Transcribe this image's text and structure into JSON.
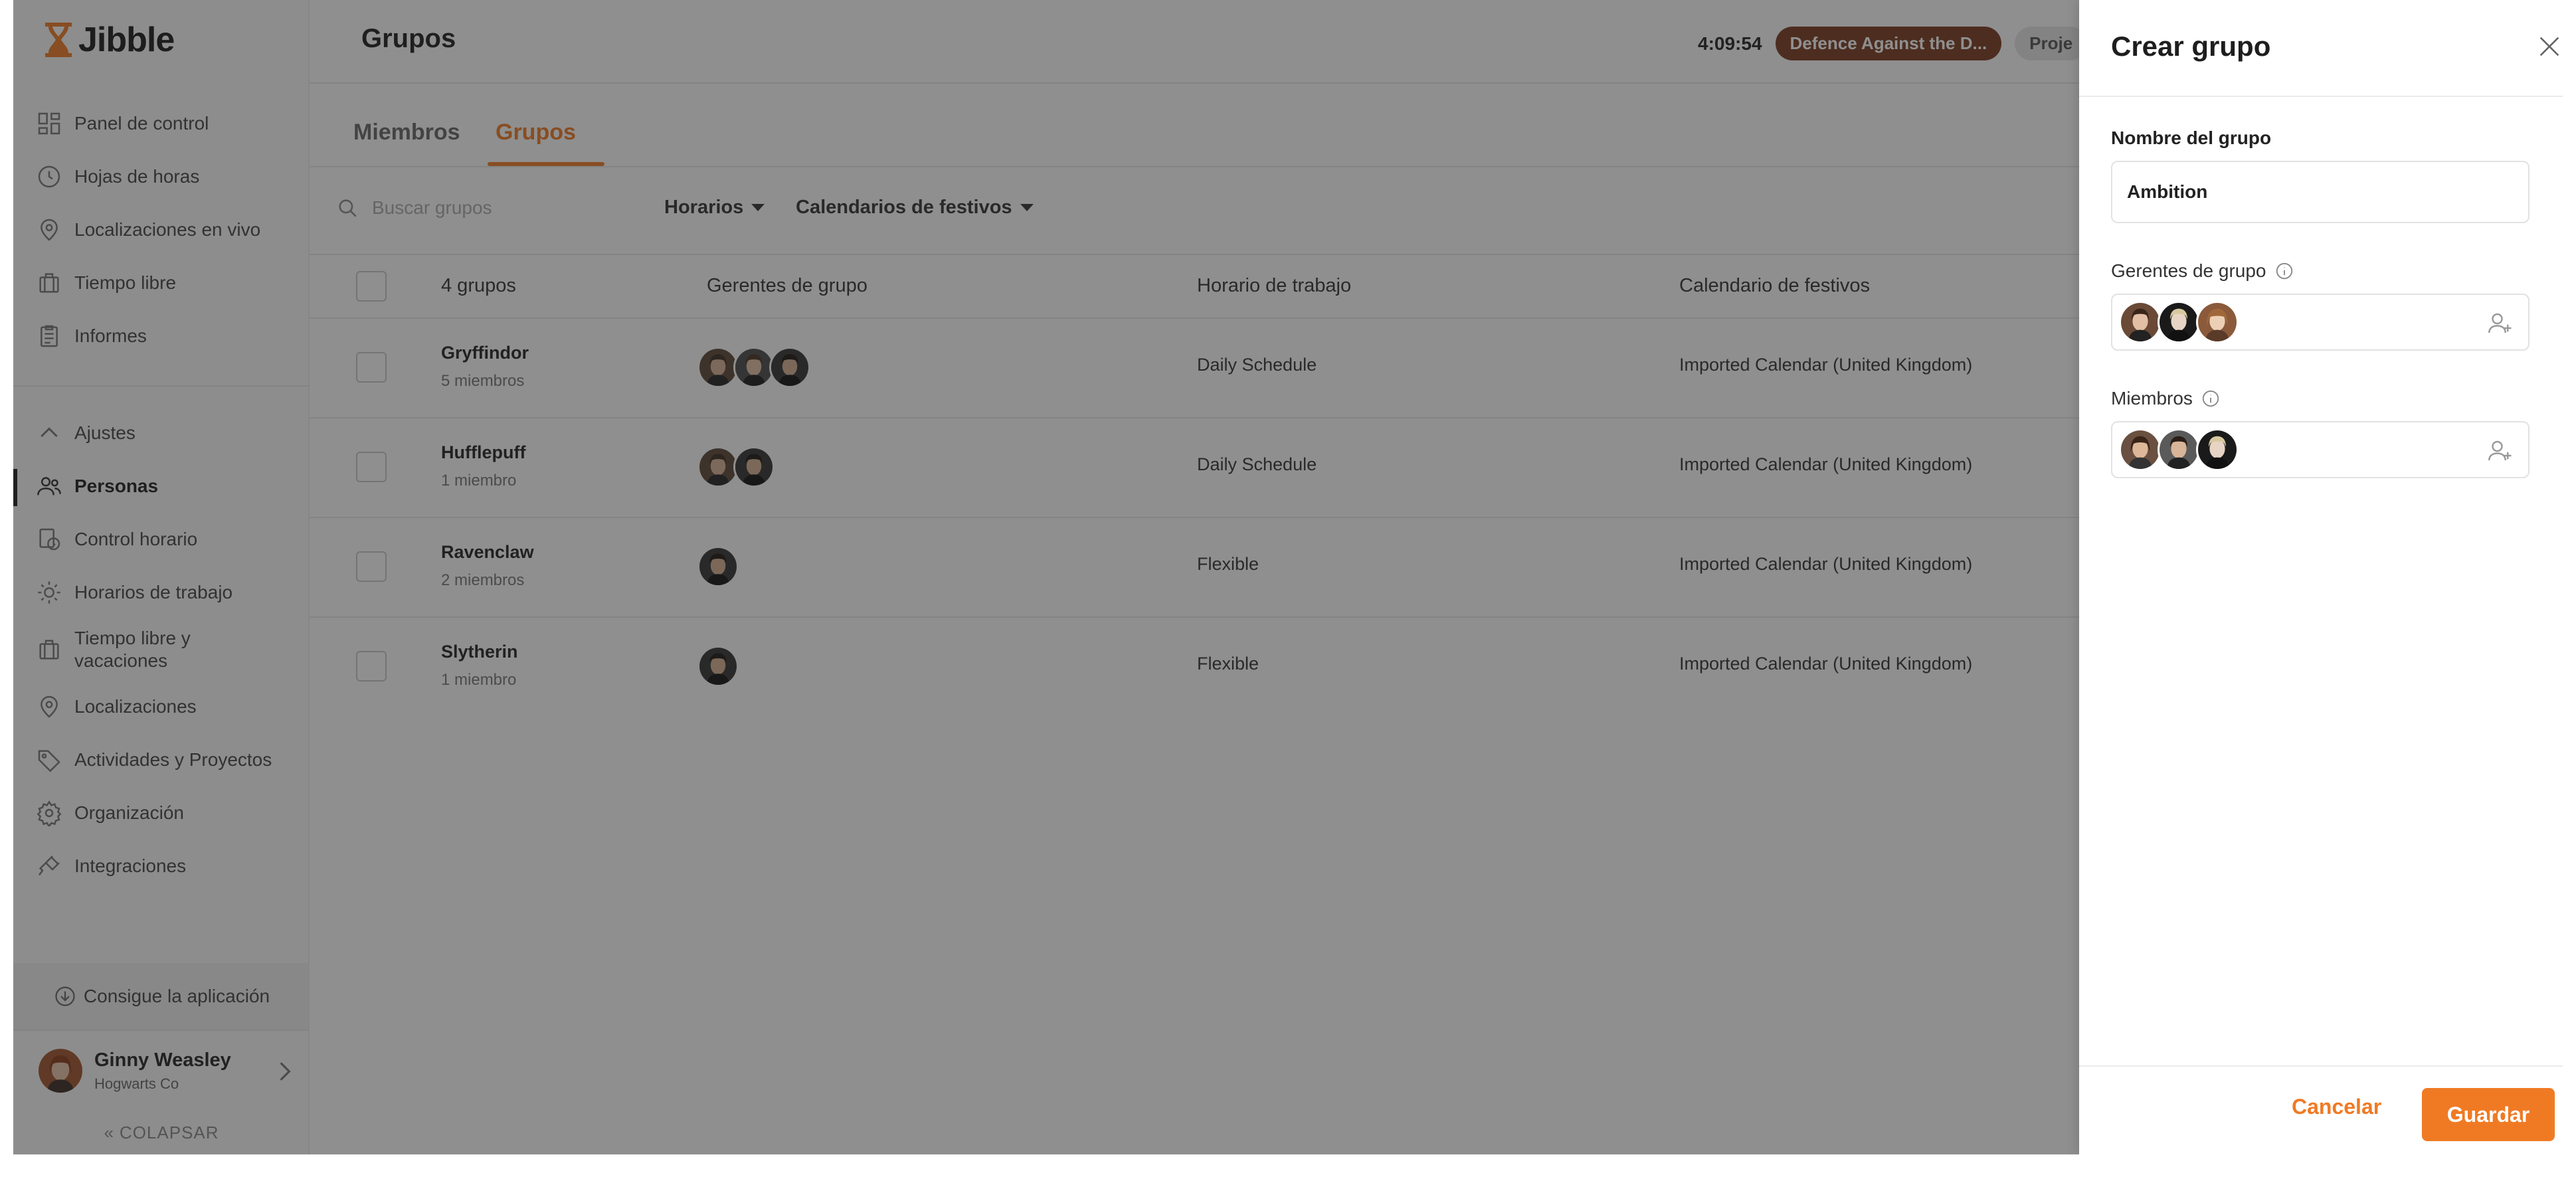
{
  "sidebar": {
    "logo_text": "Jibble",
    "nav": [
      {
        "label": "Panel de control",
        "icon": "dashboard-icon"
      },
      {
        "label": "Hojas de horas",
        "icon": "clock-icon"
      },
      {
        "label": "Localizaciones en vivo",
        "icon": "location-pin-icon"
      },
      {
        "label": "Tiempo libre",
        "icon": "suitcase-icon"
      },
      {
        "label": "Informes",
        "icon": "clipboard-icon"
      }
    ],
    "settings_label": "Ajustes",
    "settings_nav": [
      {
        "label": "Personas",
        "icon": "people-icon"
      },
      {
        "label": "Control horario",
        "icon": "time-tracking-icon"
      },
      {
        "label": "Horarios de trabajo",
        "icon": "schedule-icon"
      },
      {
        "label": "Tiempo libre y vacaciones",
        "icon": "suitcase-icon"
      },
      {
        "label": "Localizaciones",
        "icon": "location-pin-icon"
      },
      {
        "label": "Actividades y Proyectos",
        "icon": "tag-icon"
      },
      {
        "label": "Organización",
        "icon": "gear-icon"
      },
      {
        "label": "Integraciones",
        "icon": "plug-icon"
      }
    ],
    "get_app": "Consigue la aplicación",
    "user": {
      "name": "Ginny Weasley",
      "org": "Hogwarts Co"
    },
    "collapse": "COLAPSAR"
  },
  "header": {
    "title": "Grupos",
    "timer": "4:09:54",
    "activity": "Defence Against the D...",
    "project": "Proje"
  },
  "tabs": {
    "members": "Miembros",
    "groups": "Grupos"
  },
  "filters": {
    "search_placeholder": "Buscar grupos",
    "schedules": "Horarios",
    "holiday_calendars": "Calendarios de festivos"
  },
  "table": {
    "columns": {
      "count": "4 grupos",
      "managers": "Gerentes de grupo",
      "schedule": "Horario de trabajo",
      "calendar": "Calendario de festivos"
    },
    "rows": [
      {
        "name": "Gryffindor",
        "members": "5 miembros",
        "schedule": "Daily Schedule",
        "calendar": "Imported Calendar (United Kingdom)"
      },
      {
        "name": "Hufflepuff",
        "members": "1 miembro",
        "schedule": "Daily Schedule",
        "calendar": "Imported Calendar (United Kingdom)"
      },
      {
        "name": "Ravenclaw",
        "members": "2 miembros",
        "schedule": "Flexible",
        "calendar": "Imported Calendar (United Kingdom)"
      },
      {
        "name": "Slytherin",
        "members": "1 miembro",
        "schedule": "Flexible",
        "calendar": "Imported Calendar (United Kingdom)"
      }
    ]
  },
  "drawer": {
    "title": "Crear grupo",
    "name_label": "Nombre del grupo",
    "name_value": "Ambition",
    "managers_label": "Gerentes de grupo",
    "members_label": "Miembros",
    "cancel": "Cancelar",
    "save": "Guardar"
  },
  "colors": {
    "accent": "#f07a24",
    "activity_pill": "#7a3b20"
  }
}
